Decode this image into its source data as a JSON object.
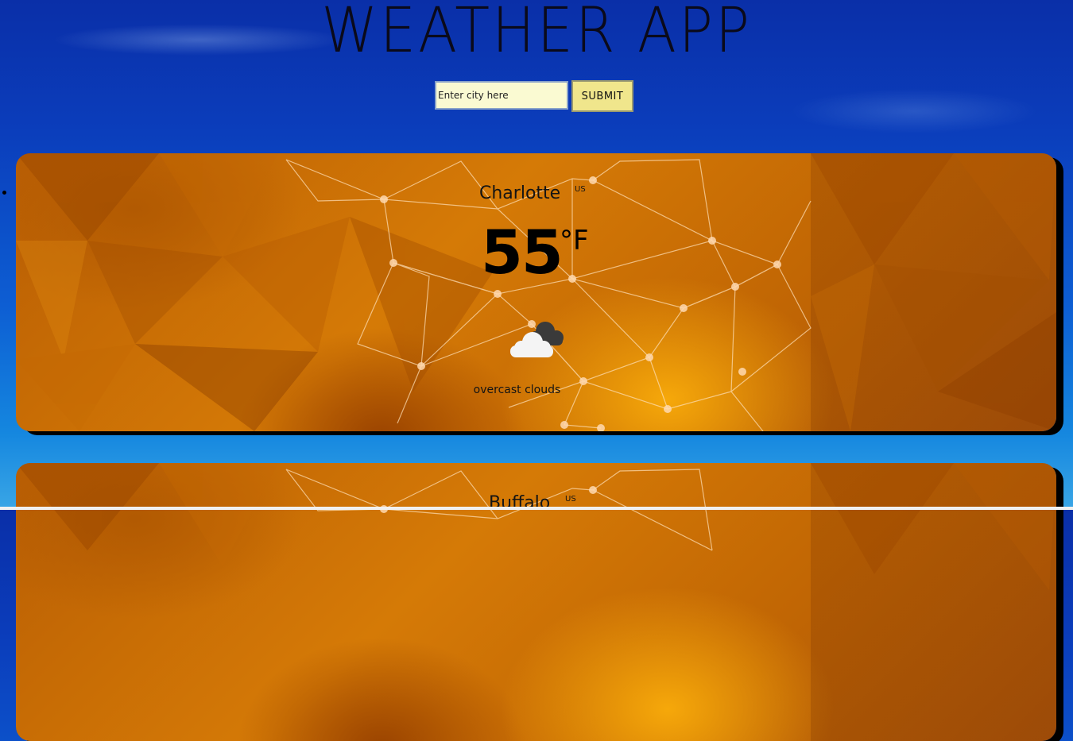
{
  "app": {
    "title": "WEATHER APP"
  },
  "search": {
    "placeholder": "Enter city here",
    "value": "",
    "submit_label": "SUBMIT"
  },
  "cards": [
    {
      "city": "Charlotte",
      "country": "US",
      "temperature": "55",
      "unit": "°F",
      "icon": "overcast-clouds-icon",
      "description": "overcast clouds"
    },
    {
      "city": "Buffalo",
      "country": "US"
    }
  ],
  "colors": {
    "card_bg": "#d57a06",
    "input_bg": "#fafad2",
    "button_bg": "#f0e68c",
    "page_bg": "#0b3dbb"
  }
}
